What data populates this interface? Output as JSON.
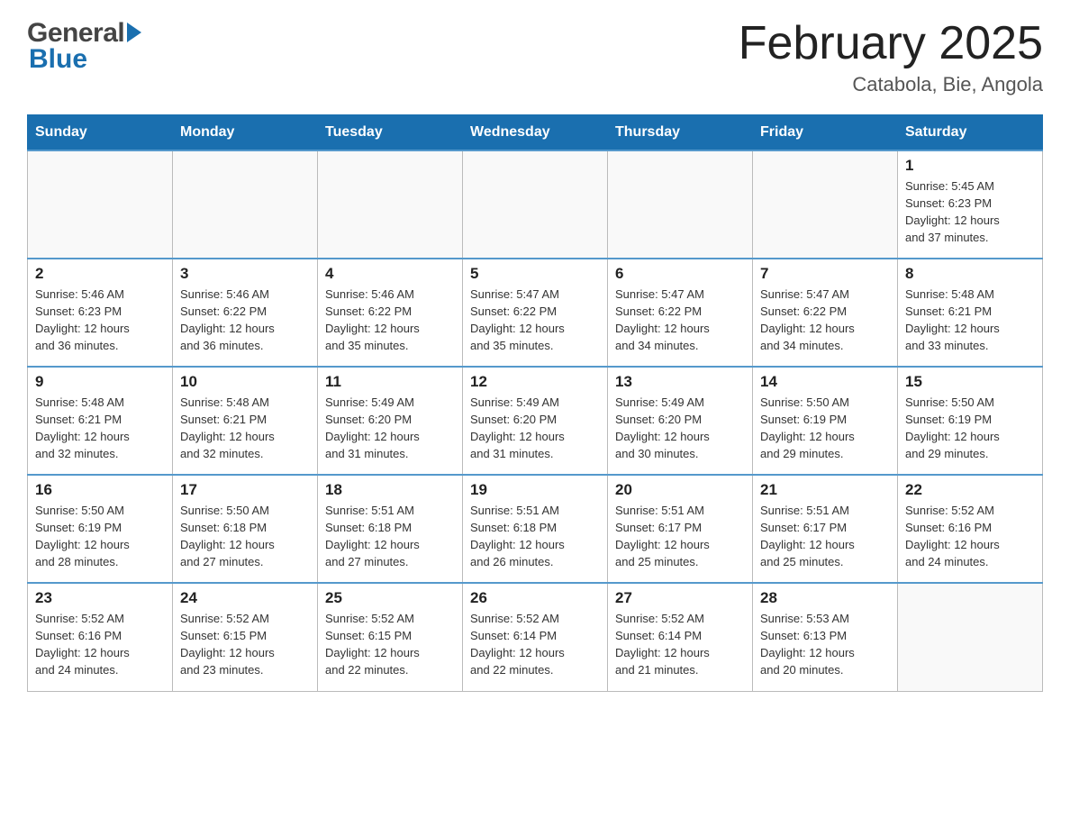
{
  "header": {
    "month_title": "February 2025",
    "location": "Catabola, Bie, Angola",
    "logo_general": "General",
    "logo_blue": "Blue"
  },
  "days_of_week": [
    "Sunday",
    "Monday",
    "Tuesday",
    "Wednesday",
    "Thursday",
    "Friday",
    "Saturday"
  ],
  "weeks": [
    [
      {
        "day": "",
        "info": ""
      },
      {
        "day": "",
        "info": ""
      },
      {
        "day": "",
        "info": ""
      },
      {
        "day": "",
        "info": ""
      },
      {
        "day": "",
        "info": ""
      },
      {
        "day": "",
        "info": ""
      },
      {
        "day": "1",
        "info": "Sunrise: 5:45 AM\nSunset: 6:23 PM\nDaylight: 12 hours\nand 37 minutes."
      }
    ],
    [
      {
        "day": "2",
        "info": "Sunrise: 5:46 AM\nSunset: 6:23 PM\nDaylight: 12 hours\nand 36 minutes."
      },
      {
        "day": "3",
        "info": "Sunrise: 5:46 AM\nSunset: 6:22 PM\nDaylight: 12 hours\nand 36 minutes."
      },
      {
        "day": "4",
        "info": "Sunrise: 5:46 AM\nSunset: 6:22 PM\nDaylight: 12 hours\nand 35 minutes."
      },
      {
        "day": "5",
        "info": "Sunrise: 5:47 AM\nSunset: 6:22 PM\nDaylight: 12 hours\nand 35 minutes."
      },
      {
        "day": "6",
        "info": "Sunrise: 5:47 AM\nSunset: 6:22 PM\nDaylight: 12 hours\nand 34 minutes."
      },
      {
        "day": "7",
        "info": "Sunrise: 5:47 AM\nSunset: 6:22 PM\nDaylight: 12 hours\nand 34 minutes."
      },
      {
        "day": "8",
        "info": "Sunrise: 5:48 AM\nSunset: 6:21 PM\nDaylight: 12 hours\nand 33 minutes."
      }
    ],
    [
      {
        "day": "9",
        "info": "Sunrise: 5:48 AM\nSunset: 6:21 PM\nDaylight: 12 hours\nand 32 minutes."
      },
      {
        "day": "10",
        "info": "Sunrise: 5:48 AM\nSunset: 6:21 PM\nDaylight: 12 hours\nand 32 minutes."
      },
      {
        "day": "11",
        "info": "Sunrise: 5:49 AM\nSunset: 6:20 PM\nDaylight: 12 hours\nand 31 minutes."
      },
      {
        "day": "12",
        "info": "Sunrise: 5:49 AM\nSunset: 6:20 PM\nDaylight: 12 hours\nand 31 minutes."
      },
      {
        "day": "13",
        "info": "Sunrise: 5:49 AM\nSunset: 6:20 PM\nDaylight: 12 hours\nand 30 minutes."
      },
      {
        "day": "14",
        "info": "Sunrise: 5:50 AM\nSunset: 6:19 PM\nDaylight: 12 hours\nand 29 minutes."
      },
      {
        "day": "15",
        "info": "Sunrise: 5:50 AM\nSunset: 6:19 PM\nDaylight: 12 hours\nand 29 minutes."
      }
    ],
    [
      {
        "day": "16",
        "info": "Sunrise: 5:50 AM\nSunset: 6:19 PM\nDaylight: 12 hours\nand 28 minutes."
      },
      {
        "day": "17",
        "info": "Sunrise: 5:50 AM\nSunset: 6:18 PM\nDaylight: 12 hours\nand 27 minutes."
      },
      {
        "day": "18",
        "info": "Sunrise: 5:51 AM\nSunset: 6:18 PM\nDaylight: 12 hours\nand 27 minutes."
      },
      {
        "day": "19",
        "info": "Sunrise: 5:51 AM\nSunset: 6:18 PM\nDaylight: 12 hours\nand 26 minutes."
      },
      {
        "day": "20",
        "info": "Sunrise: 5:51 AM\nSunset: 6:17 PM\nDaylight: 12 hours\nand 25 minutes."
      },
      {
        "day": "21",
        "info": "Sunrise: 5:51 AM\nSunset: 6:17 PM\nDaylight: 12 hours\nand 25 minutes."
      },
      {
        "day": "22",
        "info": "Sunrise: 5:52 AM\nSunset: 6:16 PM\nDaylight: 12 hours\nand 24 minutes."
      }
    ],
    [
      {
        "day": "23",
        "info": "Sunrise: 5:52 AM\nSunset: 6:16 PM\nDaylight: 12 hours\nand 24 minutes."
      },
      {
        "day": "24",
        "info": "Sunrise: 5:52 AM\nSunset: 6:15 PM\nDaylight: 12 hours\nand 23 minutes."
      },
      {
        "day": "25",
        "info": "Sunrise: 5:52 AM\nSunset: 6:15 PM\nDaylight: 12 hours\nand 22 minutes."
      },
      {
        "day": "26",
        "info": "Sunrise: 5:52 AM\nSunset: 6:14 PM\nDaylight: 12 hours\nand 22 minutes."
      },
      {
        "day": "27",
        "info": "Sunrise: 5:52 AM\nSunset: 6:14 PM\nDaylight: 12 hours\nand 21 minutes."
      },
      {
        "day": "28",
        "info": "Sunrise: 5:53 AM\nSunset: 6:13 PM\nDaylight: 12 hours\nand 20 minutes."
      },
      {
        "day": "",
        "info": ""
      }
    ]
  ]
}
